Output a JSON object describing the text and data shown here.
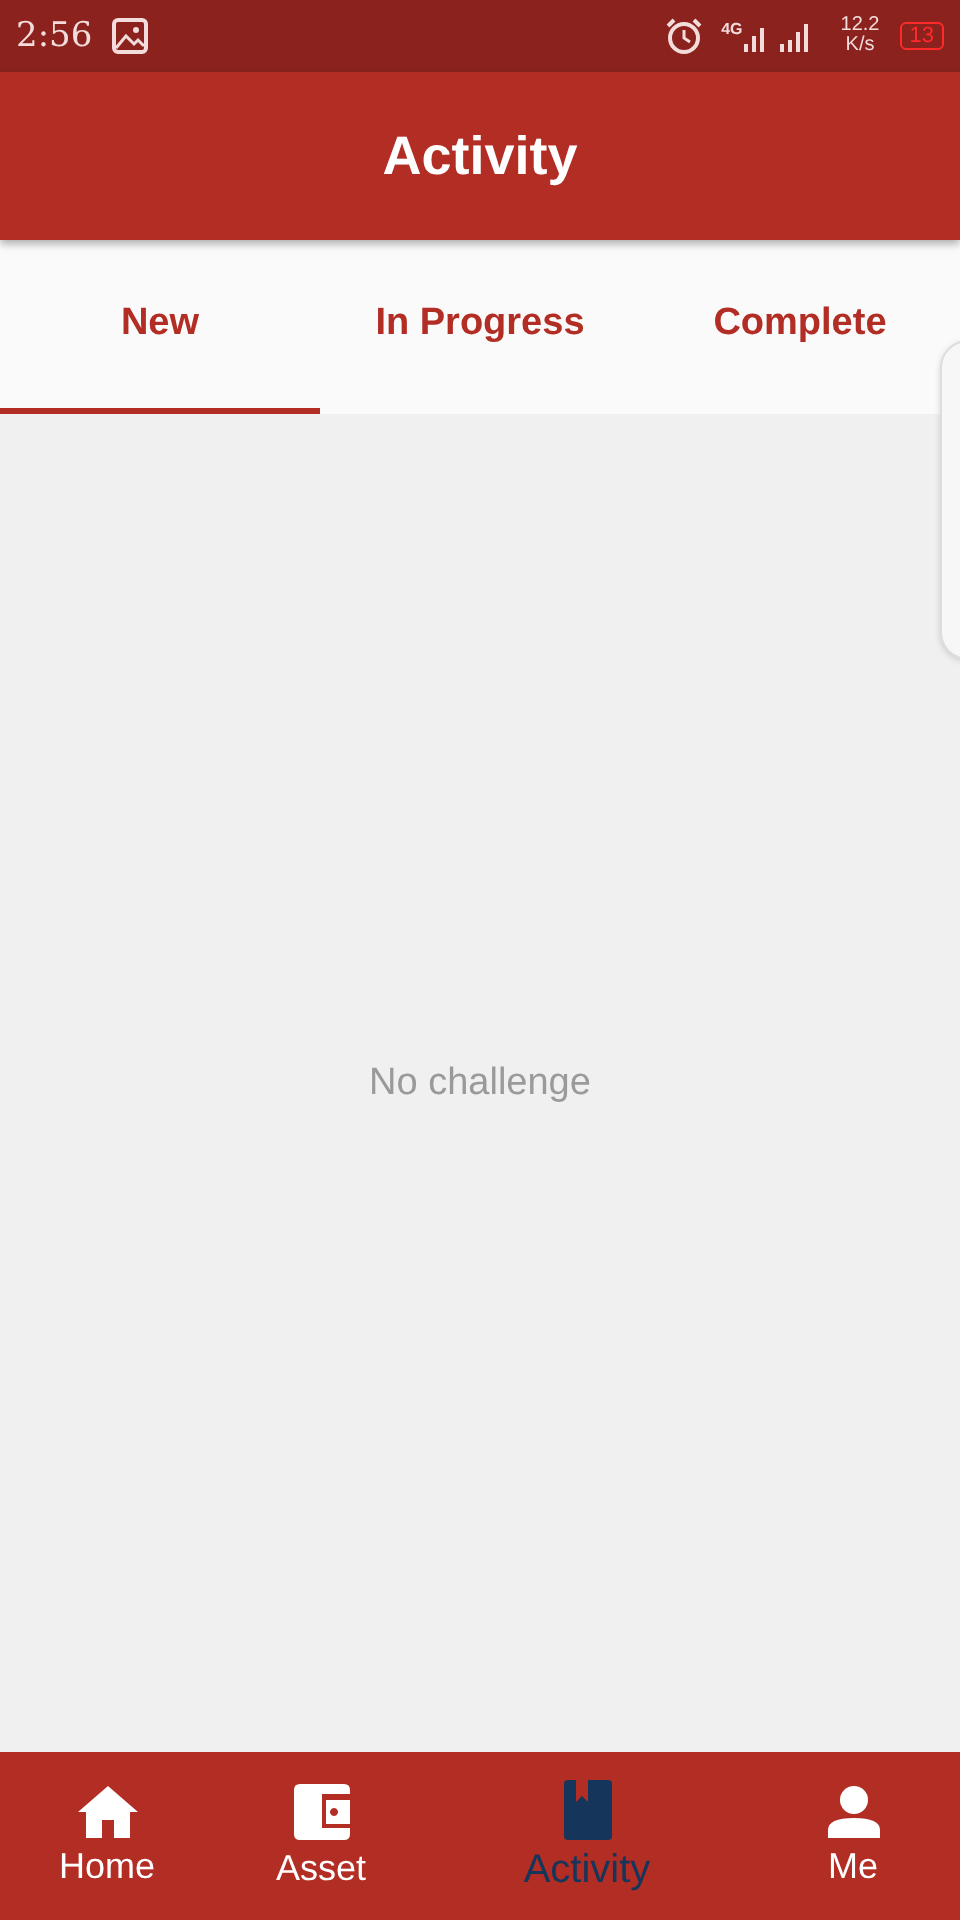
{
  "status_bar": {
    "time": "2:56",
    "network": "4G",
    "speed": "12.2",
    "speed_unit": "K/s",
    "battery": "13"
  },
  "app_bar": {
    "title": "Activity"
  },
  "tabs": [
    {
      "label": "New",
      "selected": true
    },
    {
      "label": "In Progress",
      "selected": false
    },
    {
      "label": "Complete",
      "selected": false
    }
  ],
  "empty_message": "No challenge",
  "bottom_nav": [
    {
      "label": "Home",
      "kind": "home",
      "selected": false
    },
    {
      "label": "Asset",
      "kind": "wallet",
      "selected": false
    },
    {
      "label": "Activity",
      "kind": "book",
      "selected": true
    },
    {
      "label": "Me",
      "kind": "person",
      "selected": false
    }
  ]
}
